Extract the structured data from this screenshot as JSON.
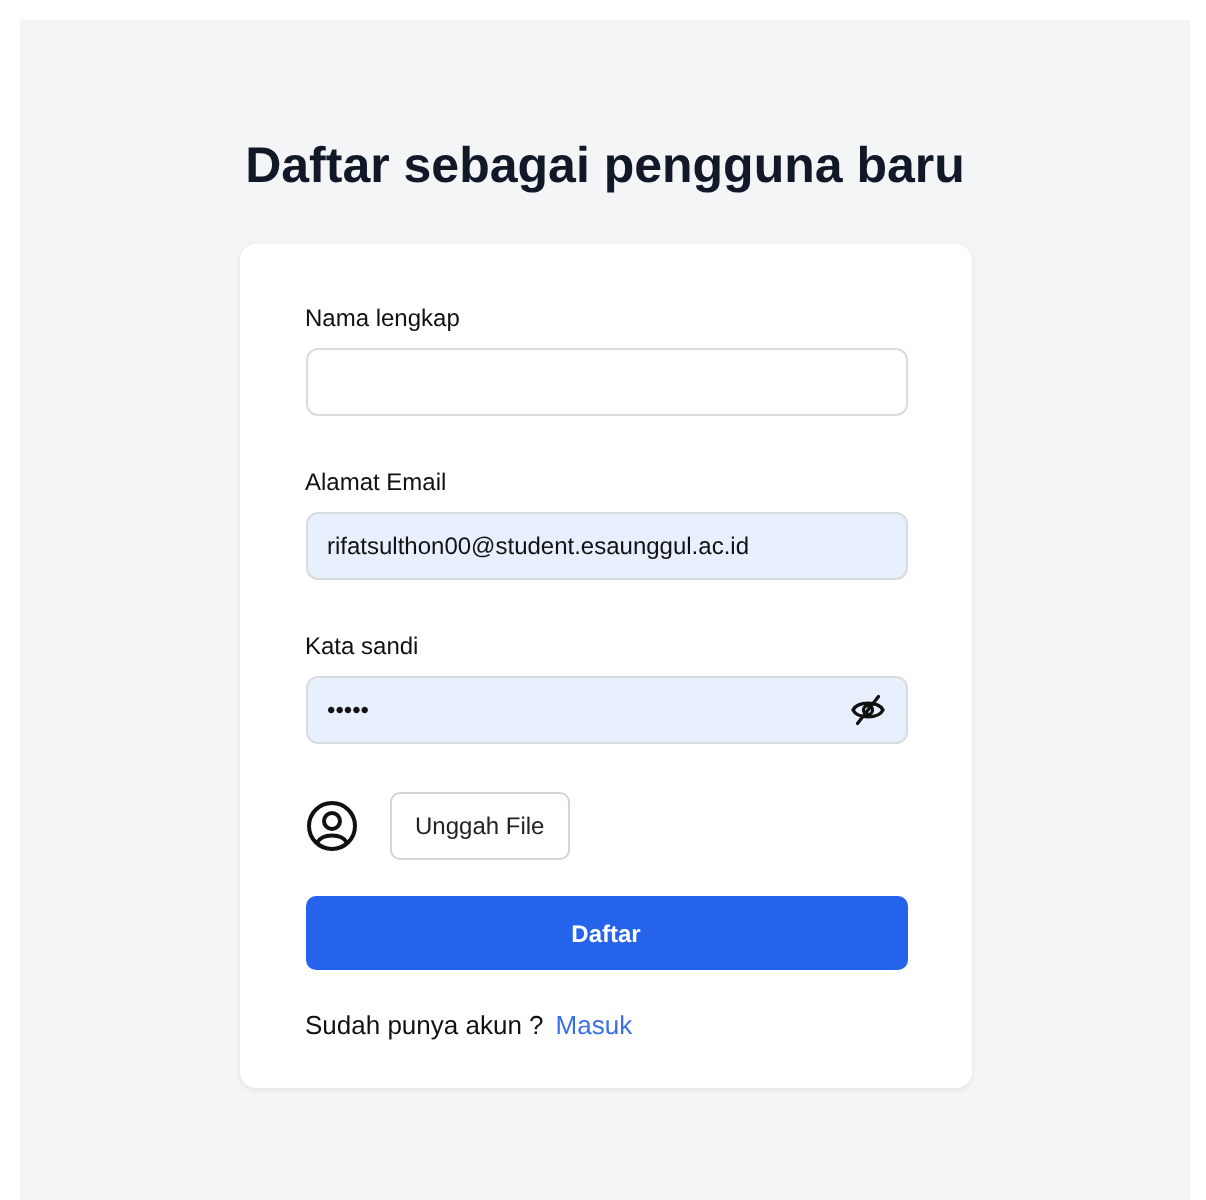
{
  "title": "Daftar sebagai pengguna baru",
  "fields": [
    {
      "label": "Nama lengkap",
      "kind": "text",
      "autofilled": false
    },
    {
      "label": "Alamat Email",
      "kind": "text",
      "value": "rifatsulthon00@student.esaunggul.ac.id",
      "autofilled": true
    },
    {
      "label": "Kata sandi",
      "kind": "password",
      "value": "•••••",
      "autofilled": true
    }
  ],
  "upload_button": "Unggah File",
  "submit_button": "Daftar",
  "footer": {
    "text": "Sudah punya akun ?",
    "link": "Masuk"
  }
}
